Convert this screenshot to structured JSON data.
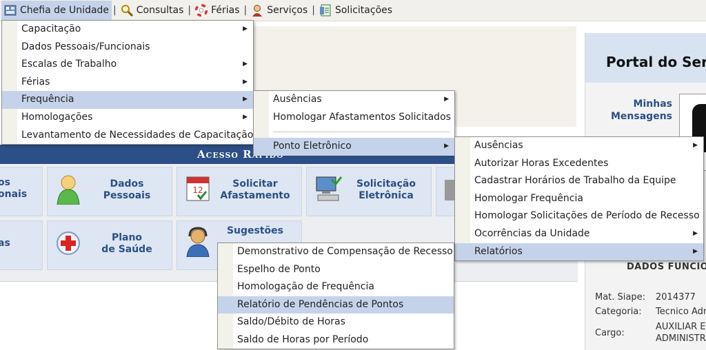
{
  "menubar": {
    "items": [
      {
        "label": "Chefia de Unidade",
        "icon": "unit-icon"
      },
      {
        "label": "Consultas",
        "icon": "magnifier-icon"
      },
      {
        "label": "Férias",
        "icon": "lifebuoy-icon"
      },
      {
        "label": "Serviços",
        "icon": "person-icon"
      },
      {
        "label": "Solicitações",
        "icon": "document-icon"
      }
    ],
    "separator": "|"
  },
  "menu_chefia": {
    "items": [
      "Capacitação",
      "Dados Pessoais/Funcionais",
      "Escalas de Trabalho",
      "Férias",
      "Frequência",
      "Homologações",
      "Levantamento de Necessidades de Capacitação"
    ]
  },
  "menu_frequencia": {
    "items": [
      "Ausências",
      "Homologar Afastamentos Solicitados",
      "Ponto Eletrônico"
    ]
  },
  "menu_ponto": {
    "items": [
      "Ausências",
      "Autorizar Horas Excedentes",
      "Cadastrar Horários de Trabalho da Equipe",
      "Homologar Frequência",
      "Homologar Solicitações de Período de Recesso",
      "Ocorrências da Unidade",
      "Relatórios"
    ]
  },
  "menu_relatorios": {
    "items": [
      "Demonstrativo de Compensação de Recesso",
      "Espelho de Ponto",
      "Homologação de Frequência",
      "Relatório de Pendências de Pontos",
      "Saldo/Débito de Horas",
      "Saldo de Horas por Período"
    ]
  },
  "acesso": {
    "title": "Acesso Rápido",
    "tiles": [
      {
        "label": "os\nonais"
      },
      {
        "label": "Dados\nPessoais"
      },
      {
        "label": "Solicitar\nAfastamento"
      },
      {
        "label": "Solicitação\nEletrônica"
      },
      {
        "label": "as"
      },
      {
        "label": "Plano\nde Saúde"
      },
      {
        "label": "Sugestões"
      }
    ]
  },
  "portal": {
    "title": "Portal do Ser",
    "mensagens": "Minhas\nMensagens",
    "dados_title": "DADOS FUNCIO",
    "fields": [
      {
        "label": "Mat. Siape:",
        "value": "2014377"
      },
      {
        "label": "Categoria:",
        "value": "Tecnico Adr"
      },
      {
        "label": "Cargo:",
        "value": "AUXILIAR E"
      },
      {
        "label": "",
        "value": "ADMINISTRA"
      }
    ]
  },
  "colors": {
    "highlight": "#c5d3ea",
    "header_blue": "#2b4f86",
    "tile_bg": "#dde6f2"
  }
}
